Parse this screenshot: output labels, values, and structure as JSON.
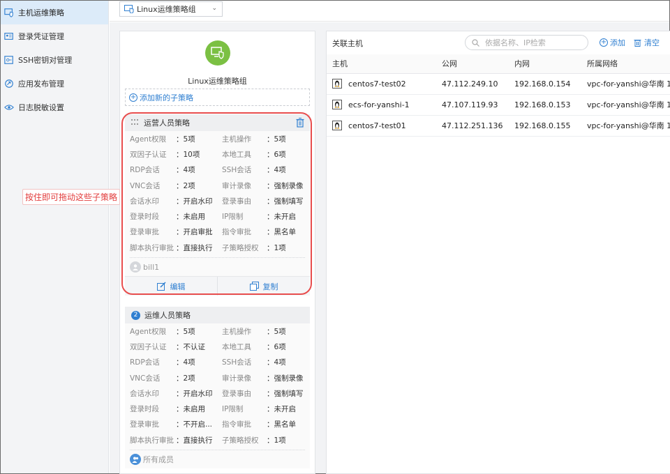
{
  "sidebar": {
    "items": [
      {
        "label": "主机运维策略",
        "icon": "host-shield-icon",
        "active": true
      },
      {
        "label": "登录凭证管理",
        "icon": "credential-icon",
        "active": false
      },
      {
        "label": "SSH密钥对管理",
        "icon": "key-icon",
        "active": false
      },
      {
        "label": "应用发布管理",
        "icon": "app-publish-icon",
        "active": false
      },
      {
        "label": "日志脱敏设置",
        "icon": "eye-icon",
        "active": false
      }
    ]
  },
  "topbar": {
    "group_select": "Linux运维策略组"
  },
  "group": {
    "name": "Linux运维策略组",
    "add_sub_label": "添加新的子策略",
    "avatar_color": "#7bc043"
  },
  "policies": [
    {
      "title": "运营人员策略",
      "rows": [
        {
          "k": "Agent权限",
          "v": "：5项",
          "k2": "主机操作",
          "v2": "：5项"
        },
        {
          "k": "双因子认证",
          "v": "：10项",
          "k2": "本地工具",
          "v2": "：6项"
        },
        {
          "k": "RDP会话",
          "v": "：4项",
          "k2": "SSH会话",
          "v2": "：4项"
        },
        {
          "k": "VNC会话",
          "v": "：2项",
          "k2": "审计录像",
          "v2": "：强制录像"
        },
        {
          "k": "会话水印",
          "v": "：开启水印",
          "k2": "登录事由",
          "v2": "：强制填写"
        },
        {
          "k": "登录时段",
          "v": "：未启用",
          "k2": "IP限制",
          "v2": "：未开启"
        },
        {
          "k": "登录审批",
          "v": "：开启审批",
          "k2": "指令审批",
          "v2": "：黑名单"
        },
        {
          "k": "脚本执行审批",
          "v": "：直接执行",
          "k2": "子策略授权",
          "v2": "：1项"
        }
      ],
      "owner": "bill1",
      "edit_label": "编辑",
      "copy_label": "复制"
    },
    {
      "number": "2",
      "title": "运维人员策略",
      "rows": [
        {
          "k": "Agent权限",
          "v": "：5项",
          "k2": "主机操作",
          "v2": "：5项"
        },
        {
          "k": "双因子认证",
          "v": "：不认证",
          "k2": "本地工具",
          "v2": "：6项"
        },
        {
          "k": "RDP会话",
          "v": "：4项",
          "k2": "SSH会话",
          "v2": "：4项"
        },
        {
          "k": "VNC会话",
          "v": "：2项",
          "k2": "审计录像",
          "v2": "：强制录像"
        },
        {
          "k": "会话水印",
          "v": "：开启水印",
          "k2": "登录事由",
          "v2": "：强制填写"
        },
        {
          "k": "登录时段",
          "v": "：未启用",
          "k2": "IP限制",
          "v2": "：未开启"
        },
        {
          "k": "登录审批",
          "v": "：不开启...",
          "k2": "指令审批",
          "v2": "：黑名单"
        },
        {
          "k": "脚本执行审批",
          "v": "：直接执行",
          "k2": "子策略授权",
          "v2": "：1项"
        }
      ],
      "owner": "所有成员"
    }
  ],
  "annotation": "按住即可拖动这些子策略",
  "hosts_panel": {
    "title": "关联主机",
    "search_placeholder": "依据名称、IP检索",
    "add_label": "添加",
    "clear_label": "清空",
    "columns": [
      "主机",
      "公网",
      "内网",
      "所属网络"
    ],
    "rows": [
      {
        "host": "centos7-test02",
        "public": "47.112.249.10",
        "private": "192.168.0.154",
        "network": "vpc-for-yanshi@华南 1"
      },
      {
        "host": "ecs-for-yanshi-1",
        "public": "47.107.119.93",
        "private": "192.168.0.153",
        "network": "vpc-for-yanshi@华南 1"
      },
      {
        "host": "centos7-test01",
        "public": "47.112.251.136",
        "private": "192.168.0.155",
        "network": "vpc-for-yanshi@华南 1"
      }
    ]
  },
  "colors": {
    "accent": "#2f7fd1",
    "highlight": "#e84d4d",
    "active_bg": "#dcebf9"
  }
}
